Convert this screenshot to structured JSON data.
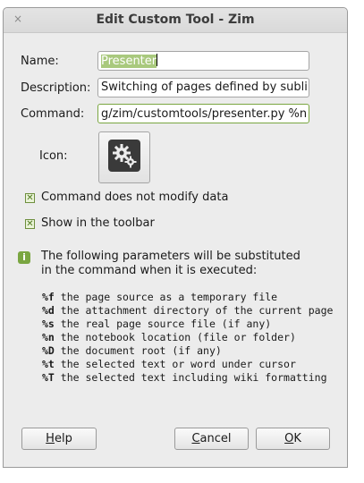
{
  "window": {
    "title": "Edit Custom Tool - Zim",
    "close_glyph": "×"
  },
  "form": {
    "name_label": "Name:",
    "name_value": "Presenter",
    "description_label": "Description:",
    "description_value": "Switching of pages defined by sublink",
    "command_label": "Command:",
    "command_value": "g/zim/customtools/presenter.py %n %d",
    "icon_label": "Icon:",
    "icon_name": "gear-icon"
  },
  "checkboxes": [
    {
      "label": "Command does not modify data",
      "checked": true
    },
    {
      "label": "Show in the toolbar",
      "checked": true
    }
  ],
  "info": {
    "line1": "The following parameters will be substituted",
    "line2": "in the command when it is executed:"
  },
  "params": [
    {
      "code": "%f",
      "desc": " the page source as a temporary file"
    },
    {
      "code": "%d",
      "desc": " the attachment directory of the current page"
    },
    {
      "code": "%s",
      "desc": " the real page source file (if any)"
    },
    {
      "code": "%n",
      "desc": " the notebook location (file or folder)"
    },
    {
      "code": "%D",
      "desc": " the document root (if any)"
    },
    {
      "code": "%t",
      "desc": " the selected text or word under cursor"
    },
    {
      "code": "%T",
      "desc": " the selected text including wiki formatting"
    }
  ],
  "buttons": {
    "help": {
      "mnemonic": "H",
      "rest": "elp"
    },
    "cancel": {
      "mnemonic": "C",
      "rest": "ancel"
    },
    "ok": {
      "mnemonic": "O",
      "rest": "K"
    }
  },
  "colors": {
    "accent": "#7aa641",
    "selection": "#a9c97d"
  }
}
